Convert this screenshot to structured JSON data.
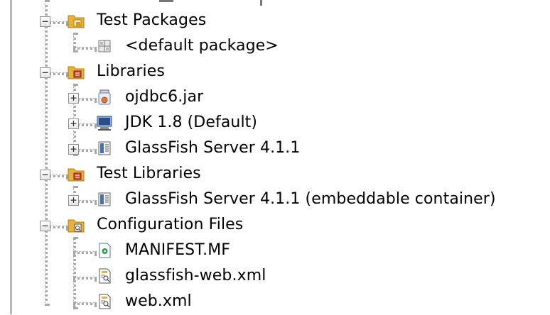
{
  "tree": {
    "items": [
      {
        "id": "test-packages",
        "label": "Test Packages",
        "expander": "−",
        "icon": "test-packages-folder-icon"
      },
      {
        "id": "default-package",
        "label": "<default package>",
        "expander": "",
        "icon": "package-icon"
      },
      {
        "id": "libraries",
        "label": "Libraries",
        "expander": "−",
        "icon": "libraries-folder-icon"
      },
      {
        "id": "ojdbc6",
        "label": "ojdbc6.jar",
        "expander": "+",
        "icon": "jar-icon"
      },
      {
        "id": "jdk",
        "label": "JDK 1.8 (Default)",
        "expander": "+",
        "icon": "jdk-icon"
      },
      {
        "id": "glassfish",
        "label": "GlassFish Server 4.1.1",
        "expander": "+",
        "icon": "server-library-icon"
      },
      {
        "id": "test-libraries",
        "label": "Test Libraries",
        "expander": "−",
        "icon": "test-libraries-folder-icon"
      },
      {
        "id": "glassfish-embeddable",
        "label": "GlassFish Server 4.1.1 (embeddable container)",
        "expander": "+",
        "icon": "server-library-icon"
      },
      {
        "id": "configuration-files",
        "label": "Configuration Files",
        "expander": "−",
        "icon": "config-folder-icon"
      },
      {
        "id": "manifest",
        "label": "MANIFEST.MF",
        "expander": "",
        "icon": "manifest-file-icon"
      },
      {
        "id": "glassfish-web-xml",
        "label": "glassfish-web.xml",
        "expander": "",
        "icon": "xml-config-file-icon"
      },
      {
        "id": "web-xml",
        "label": "web.xml",
        "expander": "",
        "icon": "xml-config-file-icon"
      }
    ]
  },
  "colors": {
    "folder": "#e8b23a",
    "folder_dark": "#b57b12",
    "library_book": "#c44a2f",
    "server_blue": "#4b6fb6",
    "manifest_green": "#2f9b4a"
  }
}
